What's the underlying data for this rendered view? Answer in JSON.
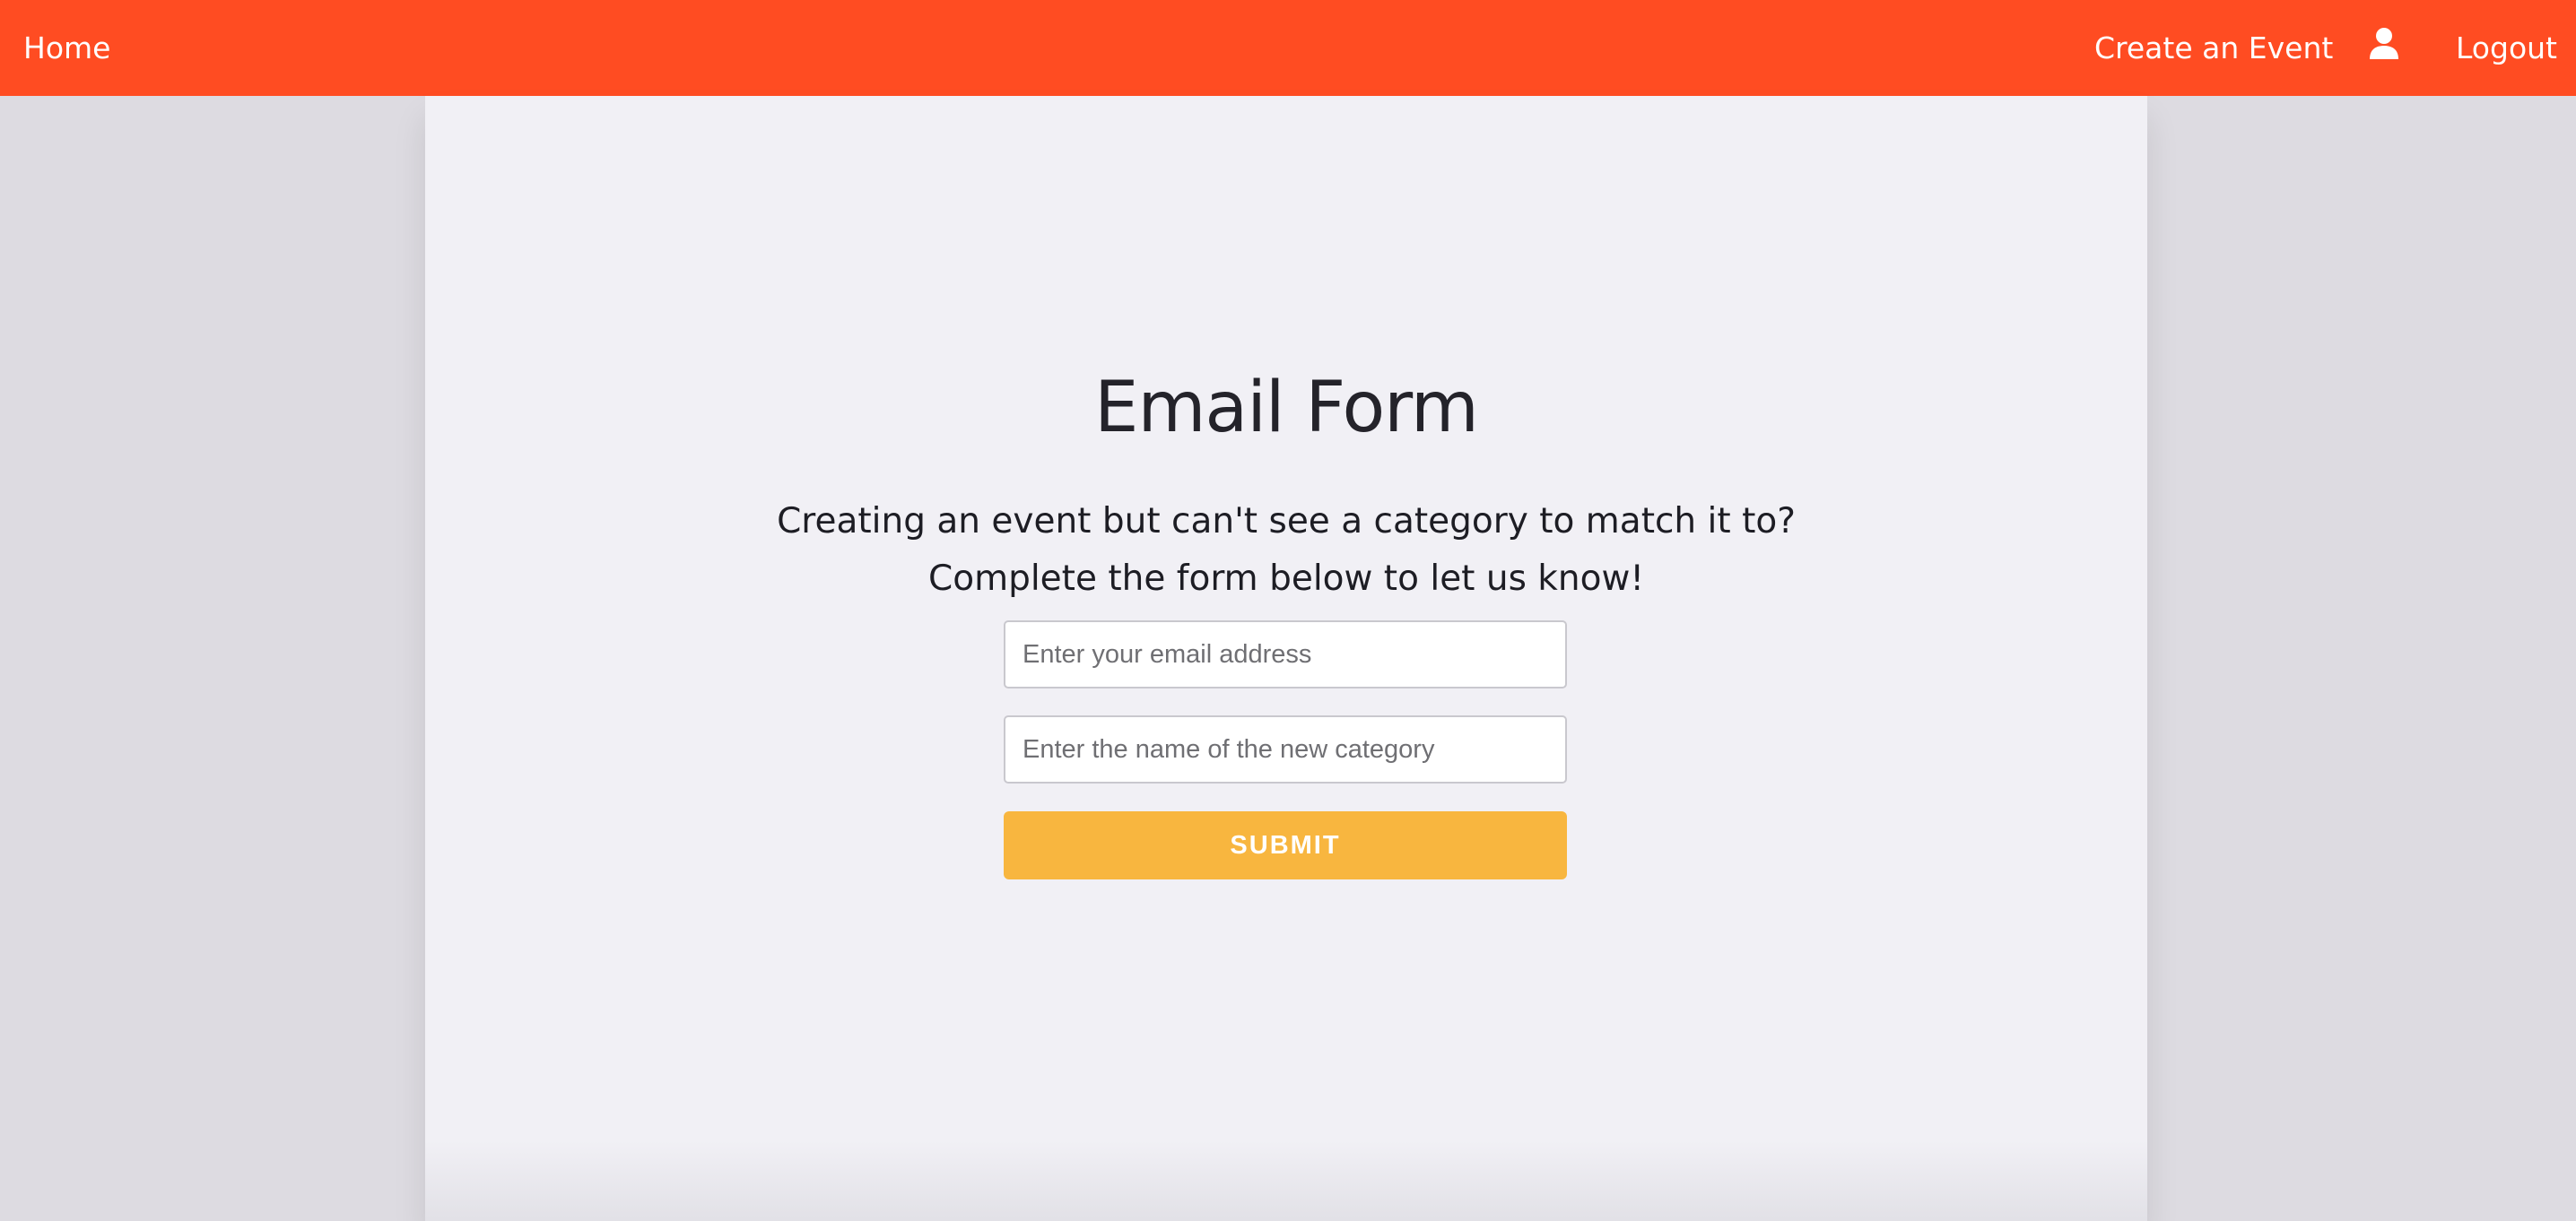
{
  "nav": {
    "home_label": "Home",
    "create_event_label": "Create an Event",
    "logout_label": "Logout",
    "user_icon": "user-icon"
  },
  "form": {
    "title": "Email Form",
    "intro": "Creating an event but can't see a category to match it to? Complete the form below to let us know!",
    "email_placeholder": "Enter your email address",
    "email_value": "",
    "category_placeholder": "Enter the name of the new category",
    "category_value": "",
    "submit_label": "SUBMIT"
  },
  "colors": {
    "nav_background": "#ff4c22",
    "page_background": "#dddbe1",
    "panel_background": "#f1f0f5",
    "submit_background": "#f8b63f",
    "text_dark": "#24232a"
  }
}
